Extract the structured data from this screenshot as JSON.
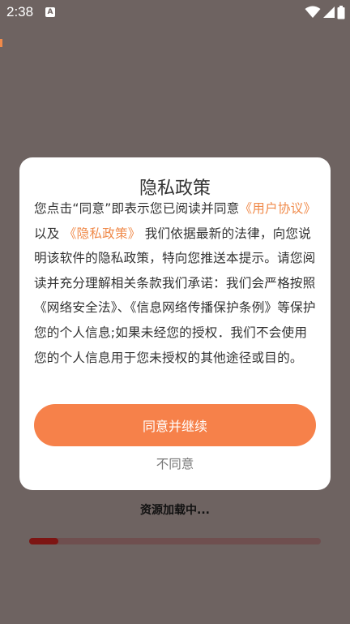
{
  "status_bar": {
    "time": "2:38",
    "notification_icon": "a-icon",
    "icons": [
      "wifi-icon",
      "signal-icon",
      "battery-icon"
    ]
  },
  "dialog": {
    "title": "隐私政策",
    "body_intro": "您点击“同意”即表示您已阅读并同意",
    "link_user_agreement": "《用户协议》",
    "body_and": "以及",
    "link_privacy_policy": "《隐私政策》",
    "body_rest": "我们依据最新的法律，向您说明该软件的隐私政策，特向您推送本提示。请您阅读并充分理解相关条款我们承诺：我们会严格按照《网络安全法》、《信息网络传播保护条例》等保护您的个人信息;如果未经您的授权．我们不会使用您的个人信息用于您未授权的其他途径或目的。",
    "agree_button": "同意并继续",
    "disagree_button": "不同意"
  },
  "loading": {
    "text": "资源加载中...",
    "progress": 0.1
  },
  "colors": {
    "accent": "#f6814a",
    "link": "#f08a4a",
    "overlay": "#6e6361",
    "progress_fill": "#7d1513"
  }
}
